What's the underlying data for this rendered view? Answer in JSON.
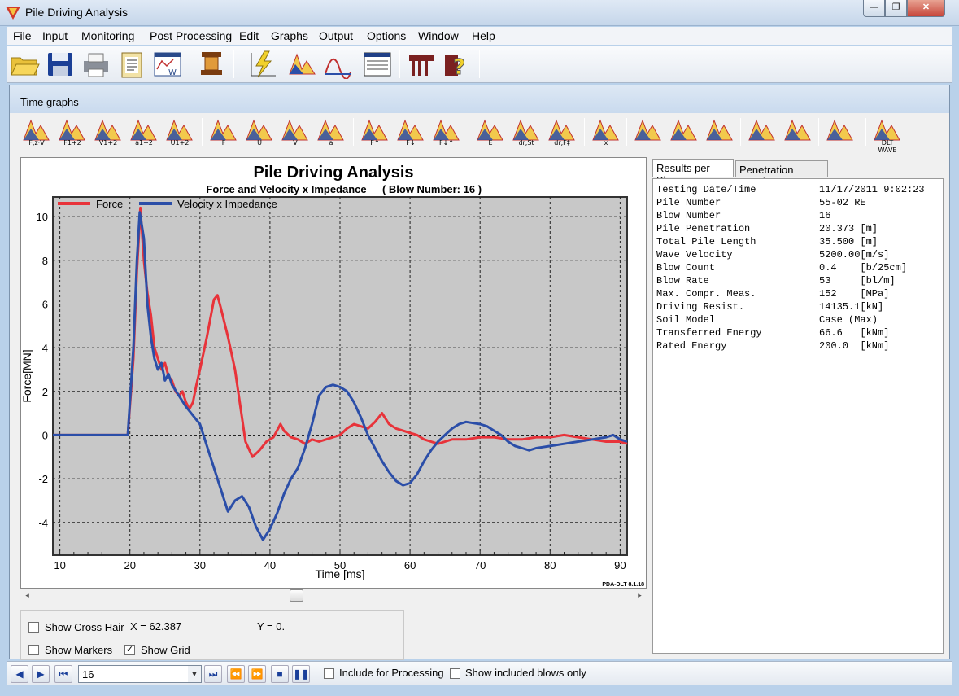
{
  "window": {
    "title": "Pile Driving Analysis",
    "min_label": "—",
    "max_label": "❐",
    "close_label": "✕"
  },
  "menu": [
    "File",
    "Input",
    "Monitoring",
    "Post Processing",
    "Edit",
    "Graphs",
    "Output",
    "Options",
    "Window",
    "Help"
  ],
  "toolbar_icons": [
    "open-folder-icon",
    "save-disk-icon",
    "print-icon",
    "clipboard-icon",
    "report-window-icon",
    "pile-hammer-icon",
    "lightning-graph-icon",
    "wave-red-icon",
    "wave-single-icon",
    "table-window-icon",
    "pile-table-icon",
    "help-question-icon"
  ],
  "child_window": {
    "title": "Time graphs"
  },
  "graph_buttons": [
    {
      "name": "force-velocity-graph",
      "label": "F,z·V"
    },
    {
      "name": "force-1-2-graph",
      "label": "F1+2"
    },
    {
      "name": "velocity-1-2-graph",
      "label": "V1+2"
    },
    {
      "name": "accel-1-2-graph",
      "label": "a1+2"
    },
    {
      "name": "disp-1-2-graph",
      "label": "U1+2"
    },
    {
      "name": "force-graph",
      "label": "F"
    },
    {
      "name": "disp-graph",
      "label": "U"
    },
    {
      "name": "velocity-graph",
      "label": "V"
    },
    {
      "name": "accel-graph",
      "label": "a"
    },
    {
      "name": "wave-up-graph",
      "label": "F↑"
    },
    {
      "name": "wave-down-graph",
      "label": "F↓"
    },
    {
      "name": "wave-updown-graph",
      "label": "F↓↑"
    },
    {
      "name": "energy-graph",
      "label": "E"
    },
    {
      "name": "dr-st-graph",
      "label": "dr,St"
    },
    {
      "name": "dr-f-graph",
      "label": "dr,F‡"
    },
    {
      "name": "force-disp-graph",
      "label": "x"
    },
    {
      "name": "compare-graph-1",
      "label": ""
    },
    {
      "name": "compare-graph-2",
      "label": ""
    },
    {
      "name": "compare-graph-3",
      "label": ""
    },
    {
      "name": "list-graph",
      "label": ""
    },
    {
      "name": "color-book-graph",
      "label": ""
    },
    {
      "name": "table-window-graph",
      "label": ""
    },
    {
      "name": "dlt-wave-graph",
      "label": "DLT WAVE"
    }
  ],
  "chart": {
    "title": "Pile Driving Analysis",
    "subtitle": "Force and Velocity x Impedance",
    "blow_label": "( Blow Number: 16 )",
    "version": "PDA-DLT 8.1.18"
  },
  "chart_data": {
    "type": "line",
    "xlabel": "Time [ms]",
    "ylabel": "Force[MN]",
    "xlim": [
      9,
      91
    ],
    "ylim": [
      -5.5,
      10.9
    ],
    "xticks": [
      10,
      20,
      30,
      40,
      50,
      60,
      70,
      80,
      90
    ],
    "yticks": [
      -4,
      -2,
      0,
      2,
      4,
      6,
      8,
      10
    ],
    "grid": true,
    "legend": "top-left",
    "series": [
      {
        "name": "Force",
        "color": "#e8333a",
        "points": [
          [
            9,
            0
          ],
          [
            19.7,
            0
          ],
          [
            20.5,
            3.5
          ],
          [
            21,
            7.5
          ],
          [
            21.5,
            10.4
          ],
          [
            22,
            8
          ],
          [
            22.5,
            6.5
          ],
          [
            23,
            5.5
          ],
          [
            23.5,
            4
          ],
          [
            24,
            3.5
          ],
          [
            24.5,
            3
          ],
          [
            25,
            3.3
          ],
          [
            25.5,
            2.7
          ],
          [
            26,
            2.5
          ],
          [
            26.5,
            2
          ],
          [
            27,
            1.8
          ],
          [
            27.5,
            2
          ],
          [
            28,
            1.5
          ],
          [
            28.5,
            1.2
          ],
          [
            29,
            1.5
          ],
          [
            29.5,
            2.3
          ],
          [
            30,
            3
          ],
          [
            31,
            4.5
          ],
          [
            32,
            6.2
          ],
          [
            32.5,
            6.4
          ],
          [
            33,
            5.8
          ],
          [
            34,
            4.5
          ],
          [
            35,
            3
          ],
          [
            36,
            0.8
          ],
          [
            36.5,
            -0.3
          ],
          [
            37.5,
            -1
          ],
          [
            38.5,
            -0.7
          ],
          [
            39.5,
            -0.3
          ],
          [
            40.5,
            -0.1
          ],
          [
            41.5,
            0.5
          ],
          [
            42,
            0.2
          ],
          [
            43,
            -0.1
          ],
          [
            44,
            -0.2
          ],
          [
            45,
            -0.4
          ],
          [
            46,
            -0.2
          ],
          [
            47,
            -0.3
          ],
          [
            48,
            -0.2
          ],
          [
            49,
            -0.1
          ],
          [
            50,
            0
          ],
          [
            51,
            0.3
          ],
          [
            52,
            0.5
          ],
          [
            53,
            0.4
          ],
          [
            54,
            0.3
          ],
          [
            55,
            0.6
          ],
          [
            56,
            1
          ],
          [
            57,
            0.5
          ],
          [
            58,
            0.3
          ],
          [
            59,
            0.2
          ],
          [
            60,
            0.1
          ],
          [
            61,
            0
          ],
          [
            62,
            -0.2
          ],
          [
            63,
            -0.3
          ],
          [
            64,
            -0.4
          ],
          [
            65,
            -0.3
          ],
          [
            66,
            -0.2
          ],
          [
            68,
            -0.2
          ],
          [
            70,
            -0.1
          ],
          [
            72,
            -0.1
          ],
          [
            74,
            -0.2
          ],
          [
            76,
            -0.2
          ],
          [
            78,
            -0.1
          ],
          [
            80,
            -0.1
          ],
          [
            82,
            0
          ],
          [
            84,
            -0.1
          ],
          [
            86,
            -0.2
          ],
          [
            88,
            -0.3
          ],
          [
            90,
            -0.3
          ],
          [
            91,
            -0.4
          ]
        ]
      },
      {
        "name": "Velocity x Impedance",
        "color": "#2b4ea8",
        "points": [
          [
            9,
            0
          ],
          [
            19.7,
            0
          ],
          [
            20.5,
            4
          ],
          [
            21,
            8
          ],
          [
            21.4,
            10.2
          ],
          [
            22,
            9
          ],
          [
            22.5,
            6
          ],
          [
            23,
            4.5
          ],
          [
            23.5,
            3.5
          ],
          [
            24,
            3
          ],
          [
            24.5,
            3.3
          ],
          [
            25,
            2.5
          ],
          [
            25.5,
            2.8
          ],
          [
            26,
            2.3
          ],
          [
            27,
            1.8
          ],
          [
            28,
            1.3
          ],
          [
            29,
            0.9
          ],
          [
            30,
            0.5
          ],
          [
            31,
            -0.5
          ],
          [
            32,
            -1.5
          ],
          [
            33,
            -2.5
          ],
          [
            34,
            -3.5
          ],
          [
            35,
            -3.0
          ],
          [
            36,
            -2.8
          ],
          [
            37,
            -3.3
          ],
          [
            38,
            -4.2
          ],
          [
            39,
            -4.8
          ],
          [
            40,
            -4.3
          ],
          [
            41,
            -3.6
          ],
          [
            42,
            -2.7
          ],
          [
            43,
            -2.0
          ],
          [
            44,
            -1.5
          ],
          [
            45,
            -0.6
          ],
          [
            46,
            0.5
          ],
          [
            47,
            1.8
          ],
          [
            48,
            2.2
          ],
          [
            49,
            2.3
          ],
          [
            50,
            2.2
          ],
          [
            51,
            2.0
          ],
          [
            52,
            1.5
          ],
          [
            53,
            0.8
          ],
          [
            54,
            0
          ],
          [
            55,
            -0.6
          ],
          [
            56,
            -1.2
          ],
          [
            57,
            -1.7
          ],
          [
            58,
            -2.1
          ],
          [
            59,
            -2.3
          ],
          [
            60,
            -2.2
          ],
          [
            61,
            -1.8
          ],
          [
            62,
            -1.2
          ],
          [
            63,
            -0.7
          ],
          [
            64,
            -0.3
          ],
          [
            65,
            0
          ],
          [
            66,
            0.3
          ],
          [
            67,
            0.5
          ],
          [
            68,
            0.6
          ],
          [
            69,
            0.55
          ],
          [
            70,
            0.5
          ],
          [
            71,
            0.4
          ],
          [
            72,
            0.2
          ],
          [
            73,
            0
          ],
          [
            74,
            -0.3
          ],
          [
            75,
            -0.5
          ],
          [
            76,
            -0.6
          ],
          [
            77,
            -0.7
          ],
          [
            78,
            -0.6
          ],
          [
            79,
            -0.55
          ],
          [
            80,
            -0.5
          ],
          [
            82,
            -0.4
          ],
          [
            84,
            -0.3
          ],
          [
            86,
            -0.2
          ],
          [
            88,
            -0.1
          ],
          [
            89,
            0
          ],
          [
            90,
            -0.2
          ],
          [
            91,
            -0.3
          ]
        ]
      }
    ]
  },
  "options": {
    "crosshair_label": "Show Cross Hair",
    "x_readout": "X = 62.387",
    "y_readout": "Y = 0.",
    "markers_label": "Show Markers",
    "grid_label": "Show Grid",
    "crosshair_checked": false,
    "markers_checked": false,
    "grid_checked": true
  },
  "tabs": [
    "Results per Blow",
    "Penetration Graphs"
  ],
  "results": [
    {
      "key": "Testing Date/Time",
      "value": "11/17/2011 9:02:23"
    },
    {
      "key": "Pile Number",
      "value": "55-02 RE"
    },
    {
      "key": "Blow Number",
      "value": "16"
    },
    {
      "key": "Pile Penetration",
      "value": "20.373 [m]"
    },
    {
      "key": "Total Pile Length",
      "value": "35.500 [m]"
    },
    {
      "key": "Wave Velocity",
      "value": "5200.00[m/s]"
    },
    {
      "key": "Blow Count",
      "value": "0.4    [b/25cm]"
    },
    {
      "key": "Blow Rate",
      "value": "53     [bl/m]"
    },
    {
      "key": "Max. Compr. Meas.",
      "value": "152    [MPa]"
    },
    {
      "key": "Driving Resist.",
      "value": "14135.1[kN]"
    },
    {
      "key": "Soil Model",
      "value": "Case (Max)"
    },
    {
      "key": "Transferred Energy",
      "value": "66.6   [kNm]"
    },
    {
      "key": "Rated Energy",
      "value": "200.0  [kNm]"
    }
  ],
  "statusbar": {
    "blow_value": "16",
    "include_label": "Include for Processing",
    "show_included_label": "Show included blows only"
  }
}
